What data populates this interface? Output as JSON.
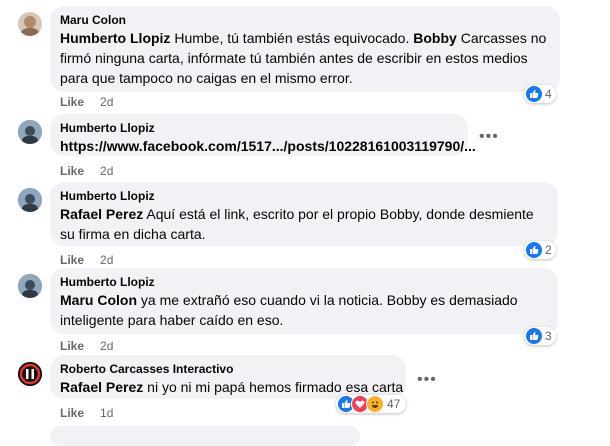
{
  "comments": [
    {
      "author": "Maru Colon",
      "mention": "Humberto Llopiz",
      "text1": " Humbe, tú también estás equivocado. ",
      "bold2": "Bobby",
      "text2": " Carcasses no firmó ninguna carta, infórmate tú también antes de escribir en estos medios para que tampoco no caigas en el mismo error.",
      "like": "Like",
      "time": "2d",
      "reactions": "4"
    },
    {
      "author": "Humberto Llopiz",
      "link": "https://www.facebook.com/1517.../posts/10228161003119790/...",
      "like": "Like",
      "time": "2d"
    },
    {
      "author": "Humberto Llopiz",
      "mention": "Rafael Perez",
      "text1": " Aquí está el link, escrito por el propio Bobby, donde desmiente su firma en dicha carta.",
      "like": "Like",
      "time": "2d",
      "reactions": "2"
    },
    {
      "author": "Humberto Llopiz",
      "mention": "Maru Colon",
      "text1": " ya me extrañó eso cuando vi la noticia. Bobby es demasiado inteligente para haber caído en eso.",
      "like": "Like",
      "time": "2d",
      "reactions": "3"
    },
    {
      "author": "Roberto Carcasses Interactivo",
      "mention": "Rafael Perez",
      "text1": " ni yo ni mi papá hemos firmado esa carta",
      "like": "Like",
      "time": "1d",
      "reactions": "47"
    }
  ],
  "colors": {
    "like_blue": "#1877f2",
    "love_red": "#f33e58",
    "haha_yellow": "#f7b125",
    "bubble": "#f0f2f5",
    "meta": "#65676b"
  },
  "icons": [
    "like-icon",
    "love-icon",
    "haha-icon",
    "more-options-icon"
  ]
}
